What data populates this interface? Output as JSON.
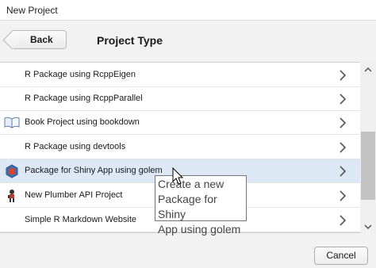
{
  "window": {
    "title": "New Project"
  },
  "header": {
    "back_label": "Back",
    "title": "Project Type"
  },
  "list": {
    "items": [
      {
        "label": "R Package using RcppEigen",
        "icon": "none"
      },
      {
        "label": "R Package using RcppParallel",
        "icon": "none"
      },
      {
        "label": "Book Project using bookdown",
        "icon": "book-icon"
      },
      {
        "label": "R Package using devtools",
        "icon": "none"
      },
      {
        "label": "Package for Shiny App using golem",
        "icon": "golem-hexagon-icon",
        "selected": true
      },
      {
        "label": "New Plumber API Project",
        "icon": "plumber-icon"
      },
      {
        "label": "Simple R Markdown Website",
        "icon": "none"
      }
    ]
  },
  "tooltip": {
    "text": "Create a new\nPackage for Shiny\nApp using golem"
  },
  "footer": {
    "cancel_label": "Cancel"
  },
  "colors": {
    "selected_row": "#dde8f5",
    "golem_blue": "#3b6fb6",
    "golem_red": "#d9432e"
  }
}
